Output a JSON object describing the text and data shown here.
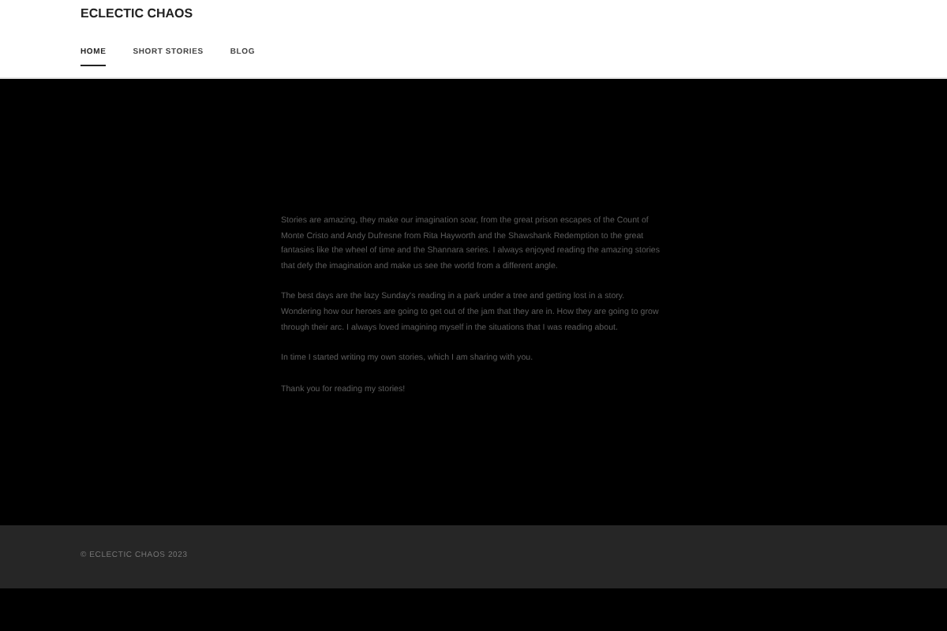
{
  "site_title": "ECLECTIC CHAOS",
  "nav": [
    {
      "label": "HOME",
      "selected": true
    },
    {
      "label": "SHORT STORIES",
      "selected": false
    },
    {
      "label": "BLOG",
      "selected": false
    }
  ],
  "paragraphs": [
    "Stories are amazing, they make our imagination soar, from the great prison escapes of the Count of Monte Cristo and Andy Dufresne from Rita Hayworth and the Shawshank Redemption to the great fantasies like the wheel of time and the Shannara series. I always enjoyed reading the amazing stories that defy the imagination and make us see the world from a different angle.",
    "The best days are the lazy Sunday's reading in a park under a tree and getting lost in a story. Wondering how our heroes are going to get out of the jam that they are in. How they are going to grow through their arc. I always loved imagining myself in the situations that I was reading about.",
    "In time I started writing my own stories, which I am sharing with you.",
    "Thank you for reading my stories!"
  ],
  "footer": "© ECLECTIC CHAOS 2023"
}
